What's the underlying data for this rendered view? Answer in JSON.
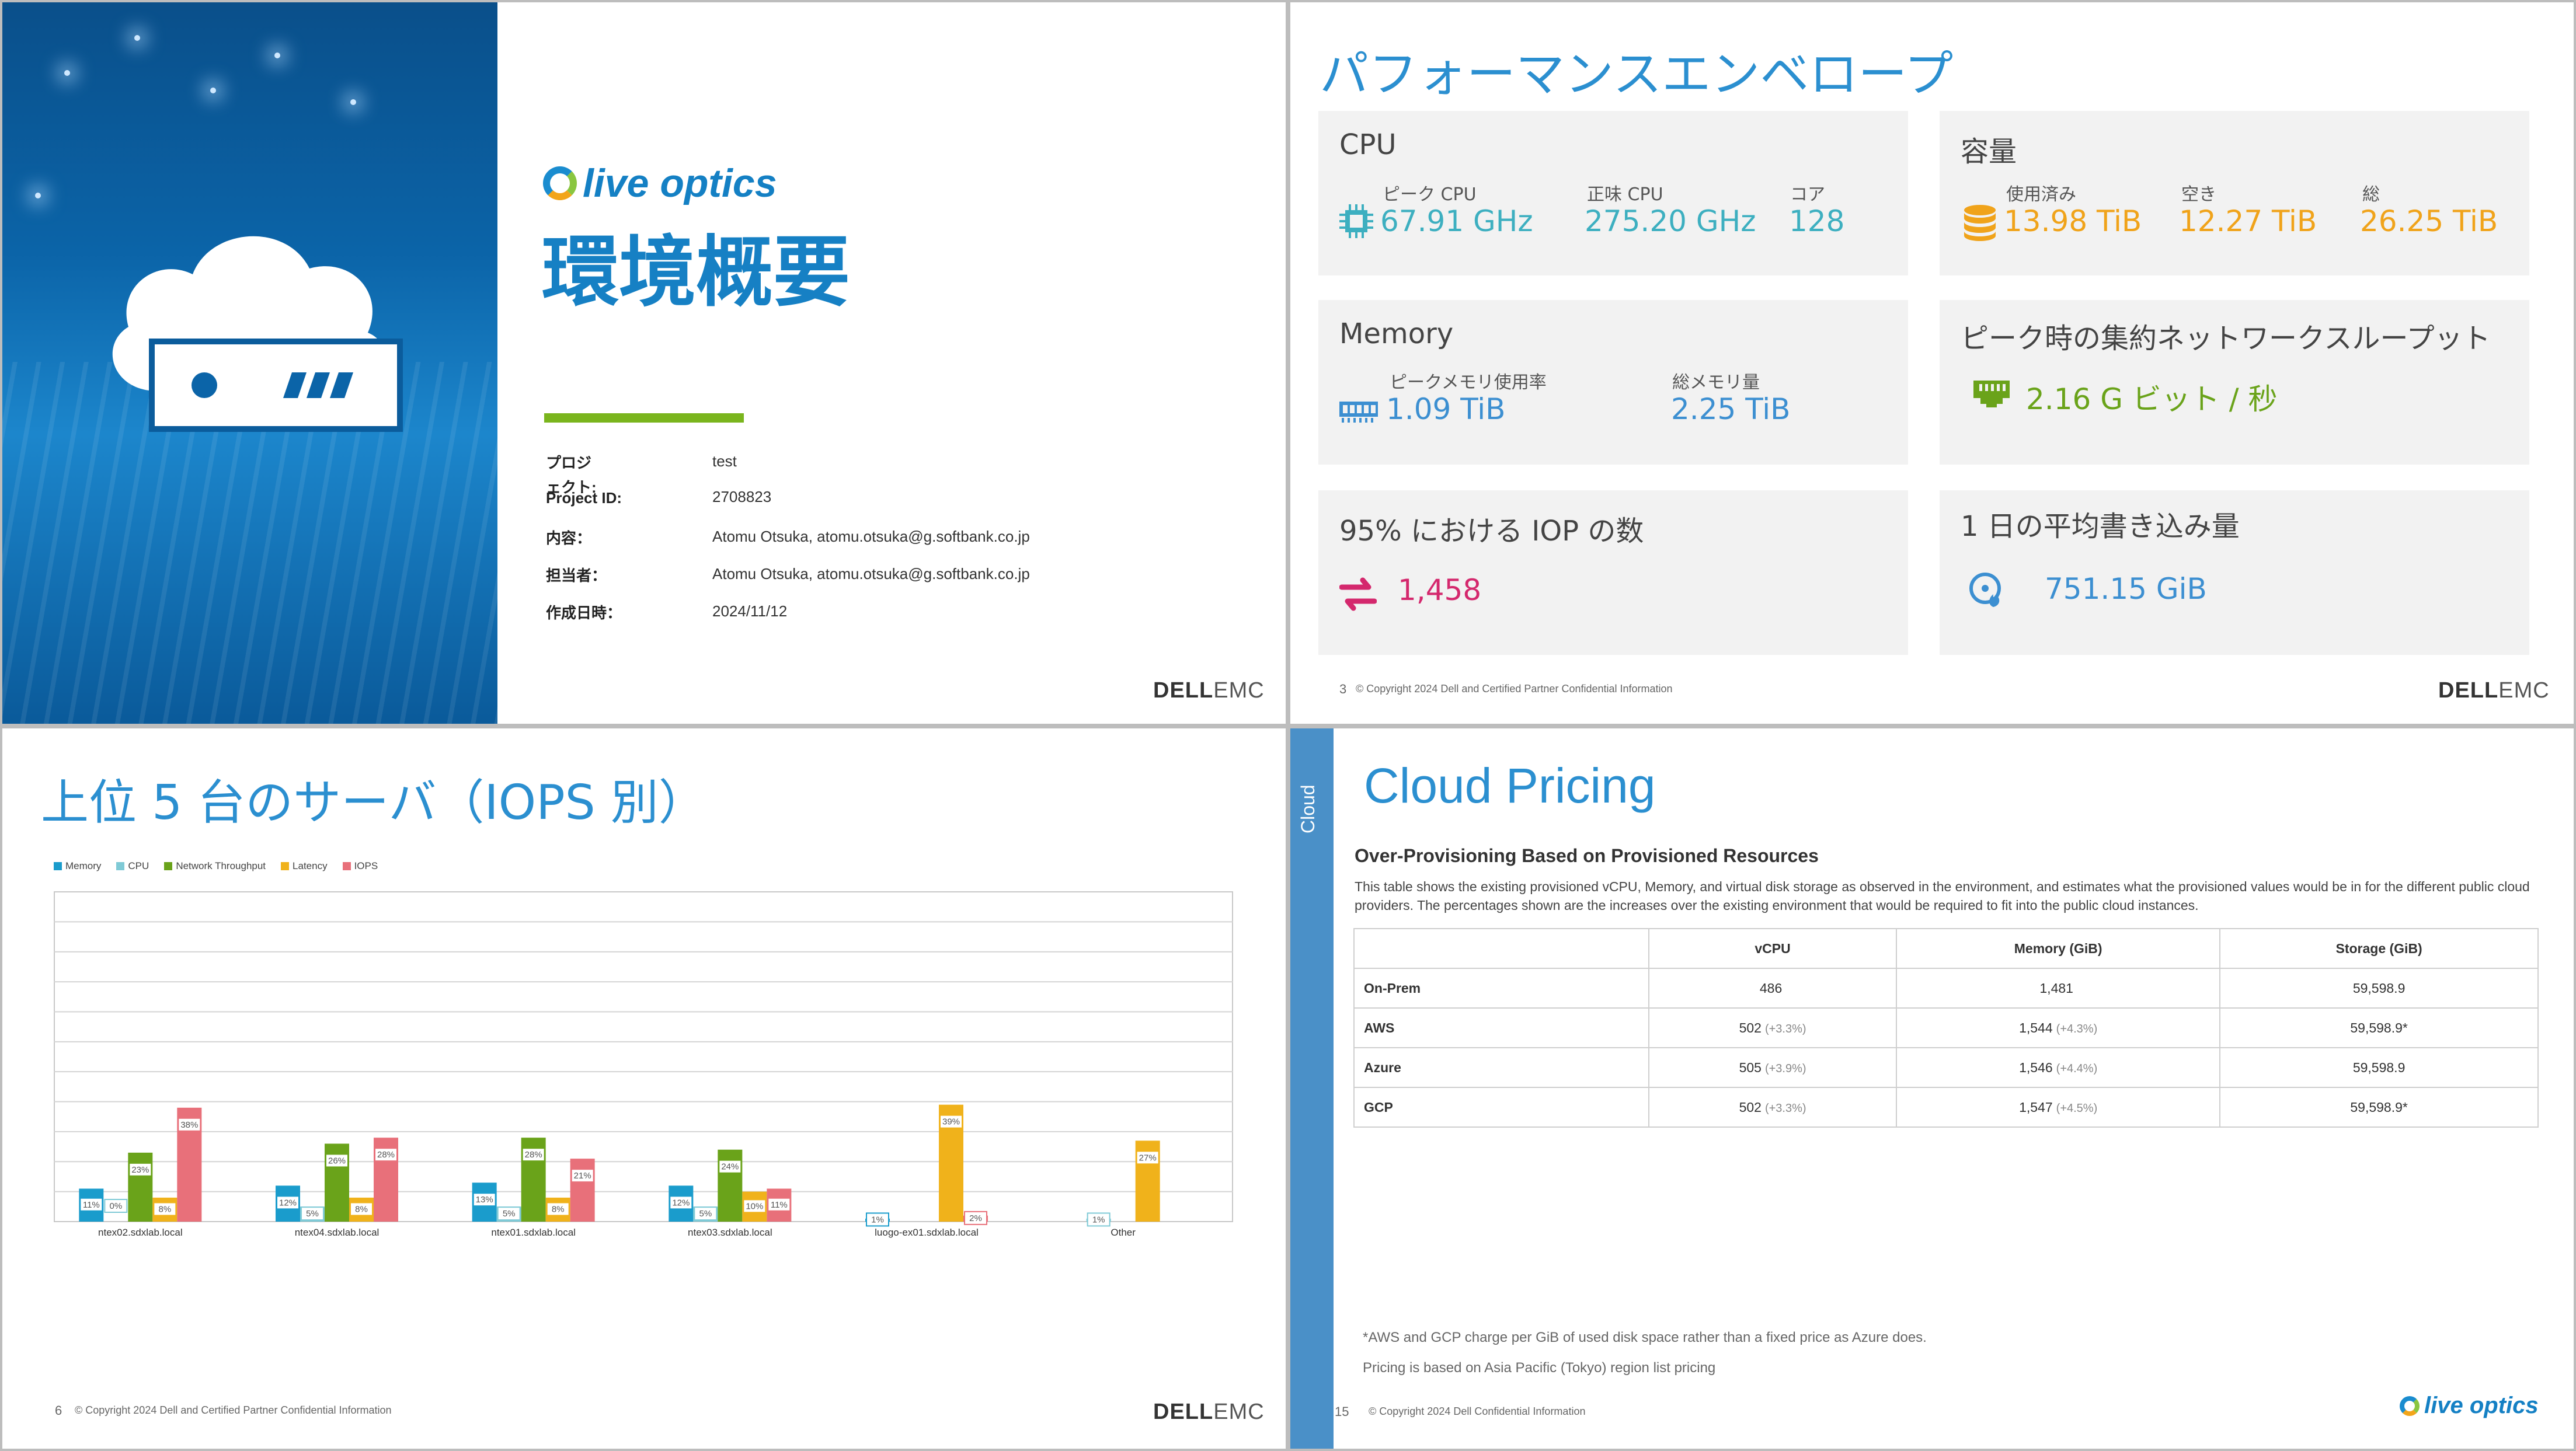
{
  "slide1": {
    "logo_text": "live optics",
    "title": "環境概要",
    "rows": [
      {
        "label": "プロジ\nェクト:",
        "value": "test"
      },
      {
        "label": "Project ID:",
        "value": "2708823"
      },
      {
        "label": "内容：",
        "value": "Atomu Otsuka, atomu.otsuka@g.softbank.co.jp"
      },
      {
        "label": "担当者：",
        "value": "Atomu Otsuka, atomu.otsuka@g.softbank.co.jp"
      },
      {
        "label": "作成日時：",
        "value": "2024/11/12"
      }
    ],
    "brand_a": "D",
    "brand_b": "ELL",
    "brand_c": "EMC"
  },
  "slide2": {
    "title": "パフォーマンスエンベロープ",
    "page": "3",
    "copyright": "© Copyright 2024 Dell and Certified Partner Confidential Information",
    "cpu": {
      "heading": "CPU",
      "labels": [
        "ピーク CPU",
        "正味 CPU",
        "コア"
      ],
      "values": [
        "67.91 GHz",
        "275.20 GHz",
        "128"
      ]
    },
    "capacity": {
      "heading": "容量",
      "labels": [
        "使用済み",
        "空き",
        "総"
      ],
      "values": [
        "13.98 TiB",
        "12.27 TiB",
        "26.25 TiB"
      ]
    },
    "memory": {
      "heading": "Memory",
      "labels": [
        "ピークメモリ使用率",
        "総メモリ量"
      ],
      "values": [
        "1.09 TiB",
        "2.25 TiB"
      ]
    },
    "network": {
      "heading": "ピーク時の集約ネットワークスループット",
      "value": "2.16 G ビット / 秒"
    },
    "iops": {
      "heading": "95% における IOP の数",
      "value": "1,458"
    },
    "writes": {
      "heading": "1 日の平均書き込み量",
      "value": "751.15 GiB"
    },
    "colors": {
      "teal": "#3dafc0",
      "orange": "#f0a31a",
      "green": "#6aa31a",
      "pink": "#d4286d",
      "blue": "#3c8fd1"
    }
  },
  "slide3": {
    "title": "上位 5 台のサーバ（IOPS 別）",
    "page": "6",
    "copyright": "© Copyright 2024 Dell and Certified Partner Confidential Information"
  },
  "chart_data": {
    "type": "bar",
    "categories": [
      "ntex02.sdxlab.local",
      "ntex04.sdxlab.local",
      "ntex01.sdxlab.local",
      "ntex03.sdxlab.local",
      "luogo-ex01.sdxlab.local",
      "Other"
    ],
    "series": [
      {
        "name": "Memory",
        "color": "#1a9ccc",
        "values": [
          11,
          12,
          13,
          12,
          1,
          0
        ],
        "labels": [
          "11%",
          "12%",
          "13%",
          "12%",
          "1%",
          ""
        ]
      },
      {
        "name": "CPU",
        "color": "#7fcad6",
        "values": [
          0,
          5,
          5,
          5,
          0,
          1
        ],
        "labels": [
          "0%",
          "5%",
          "5%",
          "5%",
          "",
          "1%"
        ]
      },
      {
        "name": "Network Throughput",
        "color": "#6aa31a",
        "values": [
          23,
          26,
          28,
          24,
          0,
          0
        ],
        "labels": [
          "23%",
          "26%",
          "28%",
          "24%",
          "",
          ""
        ]
      },
      {
        "name": "Latency",
        "color": "#f0b21b",
        "values": [
          8,
          8,
          8,
          10,
          39,
          27
        ],
        "labels": [
          "8%",
          "8%",
          "8%",
          "10%",
          "39%",
          "27%"
        ]
      },
      {
        "name": "IOPS",
        "color": "#e8707a",
        "values": [
          38,
          28,
          21,
          11,
          2,
          0
        ],
        "labels": [
          "38%",
          "28%",
          "21%",
          "11%",
          "2%",
          ""
        ]
      }
    ],
    "ylim": [
      0,
      110
    ],
    "grid": true,
    "legend": "top-left"
  },
  "slide4": {
    "side_label": "Cloud",
    "title": "Cloud Pricing",
    "subtitle": "Over-Provisioning Based on Provisioned Resources",
    "description": "This table shows the existing provisioned vCPU, Memory, and virtual disk storage as observed in the environment, and estimates what the provisioned values would be in for the different public cloud providers. The percentages shown are the increases over the existing environment that would be required to fit into the public cloud instances.",
    "columns": [
      "",
      "vCPU",
      "Memory (GiB)",
      "Storage (GiB)"
    ],
    "rows": [
      {
        "name": "On-Prem",
        "vcpu": "486",
        "vcpu_pct": "",
        "mem": "1,481",
        "mem_pct": "",
        "storage": "59,598.9"
      },
      {
        "name": "AWS",
        "vcpu": "502",
        "vcpu_pct": "(+3.3%)",
        "mem": "1,544",
        "mem_pct": "(+4.3%)",
        "storage": "59,598.9*"
      },
      {
        "name": "Azure",
        "vcpu": "505",
        "vcpu_pct": "(+3.9%)",
        "mem": "1,546",
        "mem_pct": "(+4.4%)",
        "storage": "59,598.9"
      },
      {
        "name": "GCP",
        "vcpu": "502",
        "vcpu_pct": "(+3.3%)",
        "mem": "1,547",
        "mem_pct": "(+4.5%)",
        "storage": "59,598.9*"
      }
    ],
    "note1": "*AWS and GCP charge per GiB of used disk space rather than a fixed price as Azure does.",
    "note2": "Pricing is based on Asia Pacific (Tokyo) region list pricing",
    "page": "15",
    "copyright": "© Copyright 2024 Dell Confidential Information",
    "logo_text": "live optics"
  }
}
